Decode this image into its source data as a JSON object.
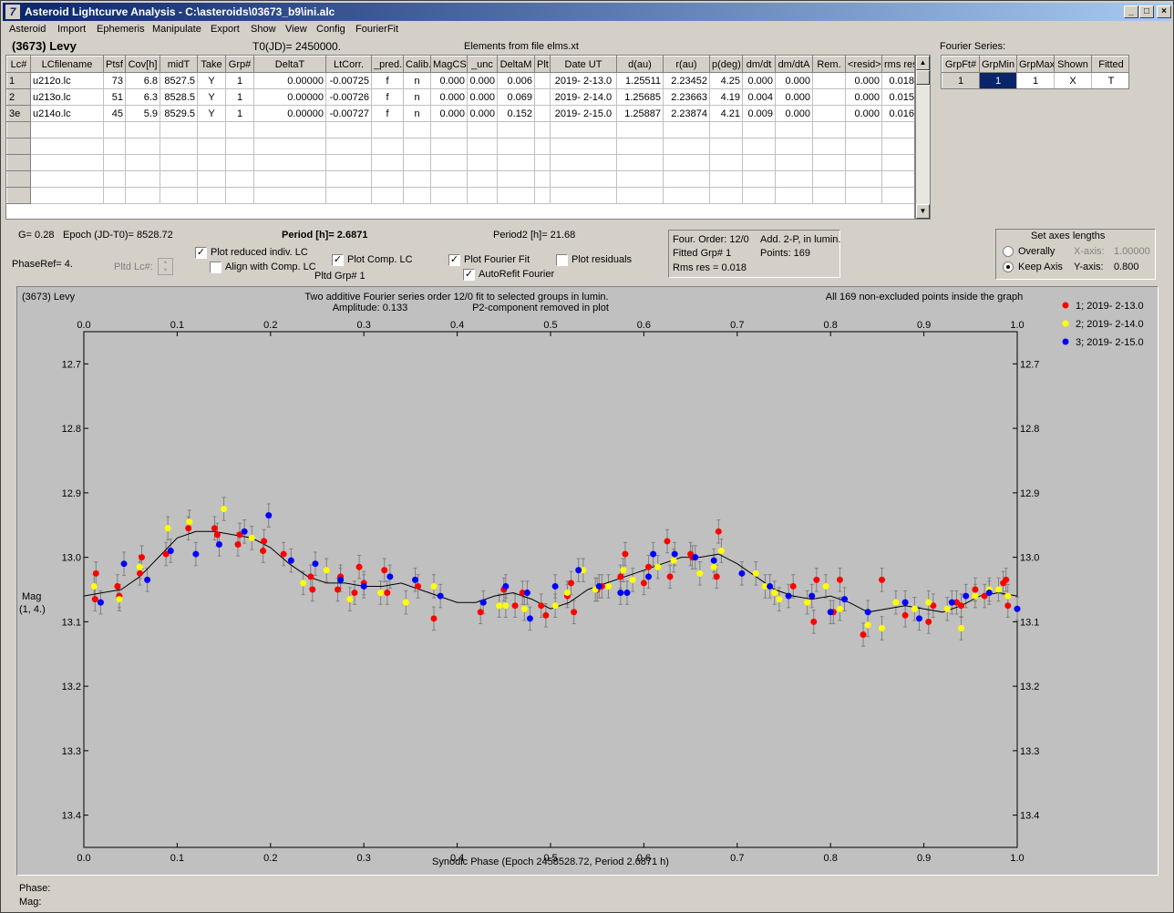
{
  "window": {
    "title": "Asteroid Lightcurve Analysis - C:\\asteroids\\03673_b9\\ini.alc",
    "icon": "app-icon"
  },
  "menu": [
    "Asteroid",
    "Import",
    "Ephemeris",
    "Manipulate",
    "Export",
    "Show",
    "View",
    "Config",
    "FourierFit"
  ],
  "header": {
    "asteroid": "(3673) Levy",
    "t0": "T0(JD)= 2450000.",
    "elements": "Elements from file elms.xt"
  },
  "lc_table": {
    "columns": [
      "Lc#",
      "LCfilename",
      "Ptsf",
      "Cov[h]",
      "midT",
      "Take",
      "Grp#",
      "DeltaT",
      "LtCorr.",
      "_pred.",
      "Calib.",
      "MagCS",
      "_unc",
      "DeltaM",
      "Plt",
      "Date UT",
      "d(au)",
      "r(au)",
      "p(deg)",
      "dm/dt",
      "dm/dtA",
      "Rem.",
      "<resid>",
      "rms res"
    ],
    "rows": [
      [
        "1",
        "u212o.lc",
        "73",
        "6.8",
        "8527.5",
        "Y",
        "1",
        "0.00000",
        "-0.00725",
        "f",
        "n",
        "0.000",
        "0.000",
        "0.006",
        "",
        "2019- 2-13.0",
        "1.25511",
        "2.23452",
        "4.25",
        "0.000",
        "0.000",
        "",
        "0.000",
        "0.018"
      ],
      [
        "2",
        "u213o.lc",
        "51",
        "6.3",
        "8528.5",
        "Y",
        "1",
        "0.00000",
        "-0.00726",
        "f",
        "n",
        "0.000",
        "0.000",
        "0.069",
        "",
        "2019- 2-14.0",
        "1.25685",
        "2.23663",
        "4.19",
        "0.004",
        "0.000",
        "",
        "0.000",
        "0.015"
      ],
      [
        "3e",
        "u214o.lc",
        "45",
        "5.9",
        "8529.5",
        "Y",
        "1",
        "0.00000",
        "-0.00727",
        "f",
        "n",
        "0.000",
        "0.000",
        "0.152",
        "",
        "2019- 2-15.0",
        "1.25887",
        "2.23874",
        "4.21",
        "0.009",
        "0.000",
        "",
        "0.000",
        "0.016"
      ]
    ]
  },
  "fourier": {
    "title": "Fourier Series:",
    "columns": [
      "GrpFt#",
      "GrpMin",
      "GrpMax",
      "Shown",
      "Fitted"
    ],
    "row": [
      "1",
      "1",
      "1",
      "X",
      "T"
    ]
  },
  "info": {
    "g": "G= 0.28",
    "epoch": "Epoch (JD-T0)= 8528.72",
    "period": "Period [h]= 2.6871",
    "period2": "Period2 [h]= 21.68",
    "phaseref": "PhaseRef= 4.",
    "pltd_lc": "Pltd Lc#:",
    "pltd_grp": "Pltd Grp#  1"
  },
  "checks": {
    "reduced": {
      "label": "Plot reduced indiv. LC",
      "checked": true
    },
    "align": {
      "label": "Align with Comp. LC",
      "checked": false
    },
    "comp": {
      "label": "Plot Comp. LC",
      "checked": true
    },
    "fourier": {
      "label": "Plot Fourier Fit",
      "checked": true
    },
    "residuals": {
      "label": "Plot residuals",
      "checked": false
    },
    "autorefit": {
      "label": "AutoRefit Fourier",
      "checked": true
    }
  },
  "fitinfo": {
    "order": "Four. Order: 12/0",
    "add": "Add. 2-P, in lumin.",
    "grp": "Fitted Grp# 1",
    "points": "Points: 169",
    "rms": "Rms res     = 0.018"
  },
  "axes_box": {
    "title": "Set axes lengths",
    "overall": "Overally",
    "keep": "Keep Axis",
    "x_label": "X-axis:",
    "x_value": "1.00000",
    "y_label": "Y-axis:",
    "y_value": "0.800",
    "selected": "keep"
  },
  "plot_text": {
    "object": "(3673) Levy",
    "line1": "Two additive Fourier series order 12/0 fit to selected groups in lumin.",
    "amplitude": "Amplitude: 0.133",
    "p2": "P2-component removed in plot",
    "allpoints": "All 169 non-excluded points inside the graph",
    "ylabel1": "Mag",
    "ylabel2": "(1, 4.)"
  },
  "status": {
    "phase": "Phase:",
    "mag": "Mag:"
  },
  "colors": {
    "red": "#ff0000",
    "yellow": "#ffff00",
    "blue": "#0000ff",
    "curve": "#000000",
    "plot_bg": "#c0c0c0",
    "title_start": "#0a246a",
    "title_end": "#a6caf0"
  },
  "chart_data": {
    "type": "scatter",
    "xlabel": "Synodic Phase (Epoch 2458528.72, Period 2.6871 h)",
    "ylabel": "Mag",
    "xlim": [
      0.0,
      1.0
    ],
    "ylim": [
      13.45,
      12.65
    ],
    "y_inverted": true,
    "xticks": [
      "0.0",
      "0.1",
      "0.2",
      "0.3",
      "0.4",
      "0.5",
      "0.6",
      "0.7",
      "0.8",
      "0.9",
      "1.0"
    ],
    "yticks": [
      "12.7",
      "12.8",
      "12.9",
      "13.0",
      "13.1",
      "13.2",
      "13.3",
      "13.4"
    ],
    "legend_position": "top-right",
    "series": [
      {
        "name": "1; 2019- 2-13.0",
        "color": "#ff0000",
        "points": [
          [
            0.012,
            13.065
          ],
          [
            0.013,
            13.025
          ],
          [
            0.036,
            13.045
          ],
          [
            0.038,
            13.06
          ],
          [
            0.06,
            13.025
          ],
          [
            0.062,
            13.0
          ],
          [
            0.088,
            12.995
          ],
          [
            0.112,
            12.955
          ],
          [
            0.14,
            12.955
          ],
          [
            0.143,
            12.965
          ],
          [
            0.165,
            12.98
          ],
          [
            0.167,
            12.965
          ],
          [
            0.192,
            12.99
          ],
          [
            0.193,
            12.975
          ],
          [
            0.214,
            12.995
          ],
          [
            0.243,
            13.03
          ],
          [
            0.245,
            13.05
          ],
          [
            0.272,
            13.05
          ],
          [
            0.275,
            13.03
          ],
          [
            0.29,
            13.055
          ],
          [
            0.295,
            13.015
          ],
          [
            0.3,
            13.04
          ],
          [
            0.322,
            13.02
          ],
          [
            0.325,
            13.055
          ],
          [
            0.358,
            13.045
          ],
          [
            0.375,
            13.095
          ],
          [
            0.425,
            13.085
          ],
          [
            0.45,
            13.05
          ],
          [
            0.462,
            13.075
          ],
          [
            0.47,
            13.055
          ],
          [
            0.49,
            13.075
          ],
          [
            0.495,
            13.09
          ],
          [
            0.518,
            13.06
          ],
          [
            0.522,
            13.04
          ],
          [
            0.525,
            13.085
          ],
          [
            0.55,
            13.05
          ],
          [
            0.555,
            13.045
          ],
          [
            0.575,
            13.03
          ],
          [
            0.58,
            12.995
          ],
          [
            0.6,
            13.04
          ],
          [
            0.605,
            13.015
          ],
          [
            0.625,
            12.975
          ],
          [
            0.628,
            13.03
          ],
          [
            0.65,
            12.995
          ],
          [
            0.652,
            13.0
          ],
          [
            0.678,
            13.03
          ],
          [
            0.68,
            12.96
          ],
          [
            0.76,
            13.045
          ],
          [
            0.785,
            13.035
          ],
          [
            0.782,
            13.1
          ],
          [
            0.803,
            13.085
          ],
          [
            0.81,
            13.035
          ],
          [
            0.835,
            13.12
          ],
          [
            0.855,
            13.035
          ],
          [
            0.88,
            13.09
          ],
          [
            0.905,
            13.1
          ],
          [
            0.91,
            13.075
          ],
          [
            0.935,
            13.07
          ],
          [
            0.94,
            13.075
          ],
          [
            0.955,
            13.05
          ],
          [
            0.965,
            13.06
          ],
          [
            0.985,
            13.04
          ],
          [
            0.988,
            13.035
          ],
          [
            0.99,
            13.075
          ]
        ]
      },
      {
        "name": "2; 2019- 2-14.0",
        "color": "#ffff00",
        "points": [
          [
            0.011,
            13.045
          ],
          [
            0.038,
            13.065
          ],
          [
            0.06,
            13.015
          ],
          [
            0.09,
            12.955
          ],
          [
            0.113,
            12.945
          ],
          [
            0.15,
            12.925
          ],
          [
            0.18,
            12.97
          ],
          [
            0.235,
            13.04
          ],
          [
            0.26,
            13.02
          ],
          [
            0.285,
            13.065
          ],
          [
            0.318,
            13.055
          ],
          [
            0.345,
            13.07
          ],
          [
            0.375,
            13.045
          ],
          [
            0.445,
            13.075
          ],
          [
            0.452,
            13.075
          ],
          [
            0.472,
            13.08
          ],
          [
            0.505,
            13.075
          ],
          [
            0.518,
            13.055
          ],
          [
            0.535,
            13.02
          ],
          [
            0.548,
            13.05
          ],
          [
            0.562,
            13.045
          ],
          [
            0.578,
            13.02
          ],
          [
            0.588,
            13.035
          ],
          [
            0.615,
            13.015
          ],
          [
            0.632,
            13.005
          ],
          [
            0.66,
            13.025
          ],
          [
            0.675,
            13.015
          ],
          [
            0.683,
            12.99
          ],
          [
            0.72,
            13.025
          ],
          [
            0.73,
            13.045
          ],
          [
            0.74,
            13.055
          ],
          [
            0.745,
            13.065
          ],
          [
            0.775,
            13.07
          ],
          [
            0.795,
            13.045
          ],
          [
            0.81,
            13.08
          ],
          [
            0.84,
            13.105
          ],
          [
            0.855,
            13.11
          ],
          [
            0.87,
            13.07
          ],
          [
            0.89,
            13.08
          ],
          [
            0.905,
            13.07
          ],
          [
            0.925,
            13.08
          ],
          [
            0.94,
            13.11
          ],
          [
            0.955,
            13.06
          ],
          [
            0.97,
            13.05
          ],
          [
            0.98,
            13.05
          ],
          [
            0.99,
            13.06
          ]
        ]
      },
      {
        "name": "3; 2019- 2-15.0",
        "color": "#0000ff",
        "points": [
          [
            0.018,
            13.07
          ],
          [
            0.043,
            13.01
          ],
          [
            0.068,
            13.035
          ],
          [
            0.093,
            12.99
          ],
          [
            0.12,
            12.995
          ],
          [
            0.145,
            12.98
          ],
          [
            0.172,
            12.96
          ],
          [
            0.198,
            12.935
          ],
          [
            0.222,
            13.005
          ],
          [
            0.248,
            13.01
          ],
          [
            0.275,
            13.035
          ],
          [
            0.3,
            13.045
          ],
          [
            0.328,
            13.03
          ],
          [
            0.355,
            13.035
          ],
          [
            0.382,
            13.06
          ],
          [
            0.428,
            13.07
          ],
          [
            0.452,
            13.045
          ],
          [
            0.475,
            13.055
          ],
          [
            0.478,
            13.095
          ],
          [
            0.505,
            13.045
          ],
          [
            0.53,
            13.02
          ],
          [
            0.552,
            13.045
          ],
          [
            0.575,
            13.055
          ],
          [
            0.582,
            13.055
          ],
          [
            0.605,
            13.03
          ],
          [
            0.61,
            12.995
          ],
          [
            0.633,
            12.995
          ],
          [
            0.655,
            13.0
          ],
          [
            0.675,
            13.005
          ],
          [
            0.705,
            13.025
          ],
          [
            0.735,
            13.045
          ],
          [
            0.755,
            13.06
          ],
          [
            0.78,
            13.06
          ],
          [
            0.8,
            13.085
          ],
          [
            0.815,
            13.065
          ],
          [
            0.84,
            13.085
          ],
          [
            0.88,
            13.07
          ],
          [
            0.895,
            13.095
          ],
          [
            0.93,
            13.07
          ],
          [
            0.945,
            13.06
          ],
          [
            0.97,
            13.055
          ],
          [
            1.0,
            13.08
          ]
        ]
      }
    ],
    "fit_curve": [
      [
        0.0,
        13.06
      ],
      [
        0.02,
        13.055
      ],
      [
        0.04,
        13.05
      ],
      [
        0.06,
        13.03
      ],
      [
        0.08,
        13.0
      ],
      [
        0.1,
        12.97
      ],
      [
        0.12,
        12.96
      ],
      [
        0.14,
        12.96
      ],
      [
        0.16,
        12.965
      ],
      [
        0.18,
        12.97
      ],
      [
        0.2,
        12.985
      ],
      [
        0.22,
        13.01
      ],
      [
        0.24,
        13.03
      ],
      [
        0.26,
        13.04
      ],
      [
        0.28,
        13.04
      ],
      [
        0.3,
        13.045
      ],
      [
        0.32,
        13.045
      ],
      [
        0.34,
        13.04
      ],
      [
        0.36,
        13.05
      ],
      [
        0.38,
        13.06
      ],
      [
        0.4,
        13.07
      ],
      [
        0.42,
        13.07
      ],
      [
        0.44,
        13.06
      ],
      [
        0.46,
        13.055
      ],
      [
        0.48,
        13.065
      ],
      [
        0.5,
        13.08
      ],
      [
        0.52,
        13.07
      ],
      [
        0.54,
        13.05
      ],
      [
        0.56,
        13.04
      ],
      [
        0.58,
        13.03
      ],
      [
        0.6,
        13.02
      ],
      [
        0.62,
        13.01
      ],
      [
        0.64,
        13.0
      ],
      [
        0.66,
        13.0
      ],
      [
        0.68,
        12.995
      ],
      [
        0.7,
        13.01
      ],
      [
        0.72,
        13.03
      ],
      [
        0.74,
        13.05
      ],
      [
        0.76,
        13.06
      ],
      [
        0.78,
        13.065
      ],
      [
        0.8,
        13.06
      ],
      [
        0.82,
        13.07
      ],
      [
        0.84,
        13.085
      ],
      [
        0.86,
        13.08
      ],
      [
        0.88,
        13.075
      ],
      [
        0.9,
        13.08
      ],
      [
        0.92,
        13.085
      ],
      [
        0.94,
        13.075
      ],
      [
        0.96,
        13.06
      ],
      [
        0.98,
        13.055
      ],
      [
        1.0,
        13.06
      ]
    ]
  }
}
